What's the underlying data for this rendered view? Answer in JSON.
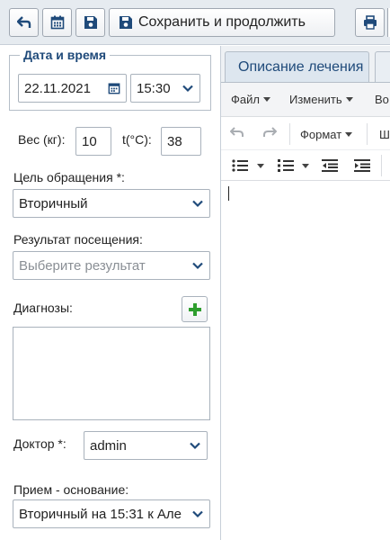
{
  "toolbar": {
    "back_icon": "back-arrow-icon",
    "calendar_icon": "calendar-icon",
    "save_icon": "floppy-disk-icon",
    "save_continue_label": "Сохранить и продолжить",
    "print_icon": "printer-icon"
  },
  "datetime": {
    "legend": "Дата и время",
    "date_value": "22.11.2021",
    "time_value": "15:30"
  },
  "vitals": {
    "weight_label": "Вес (кг):",
    "weight_value": "10",
    "temp_label": "t(°С):",
    "temp_value": "38"
  },
  "purpose": {
    "label": "Цель обращения *:",
    "value": "Вторичный"
  },
  "result": {
    "label": "Результат посещения:",
    "placeholder": "Выберите результат"
  },
  "diagnoses": {
    "label": "Диагнозы:",
    "add_icon": "plus-icon"
  },
  "doctor": {
    "label": "Доктор *:",
    "value": "admin"
  },
  "basis": {
    "label": "Прием - основание:",
    "value": "Вторичный на 15:31 к Але"
  },
  "tabs": [
    {
      "label": "Описание лечения",
      "active": true
    },
    {
      "label": "",
      "active": false
    }
  ],
  "editor": {
    "menu": [
      "Файл",
      "Изменить",
      "Во"
    ],
    "format_label": "Формат",
    "extra_label": "Ш"
  },
  "colors": {
    "accent": "#1f4a7a",
    "add_green": "#2e9e2e",
    "toolbar_bg": "#e6ebf0"
  }
}
